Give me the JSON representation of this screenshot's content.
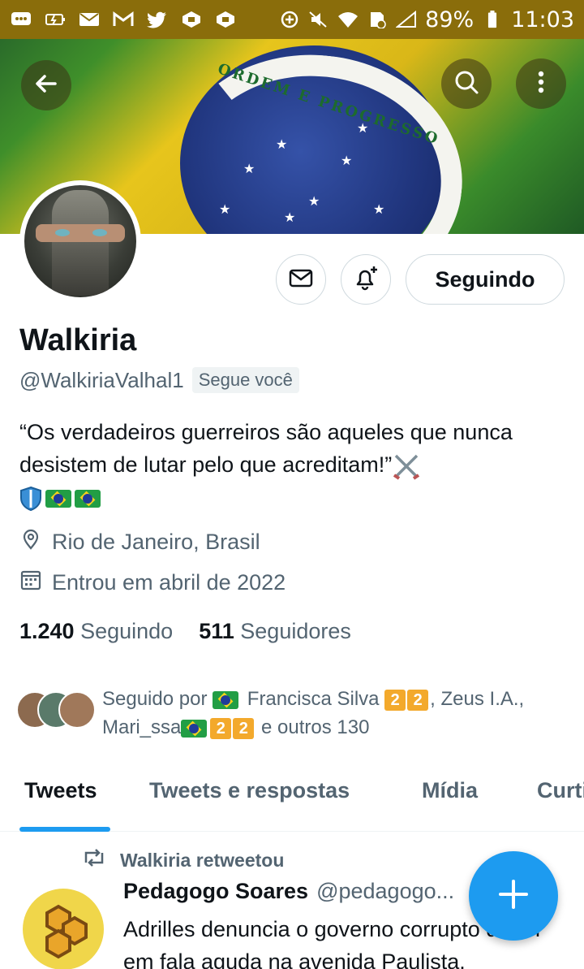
{
  "status_bar": {
    "battery": "89%",
    "time": "11:03",
    "icons": [
      "chat-icon",
      "battery-saver-icon",
      "mail-icon",
      "gmail-icon",
      "twitter-icon",
      "app-icon",
      "app-icon",
      "add-circle-icon",
      "mute-icon",
      "wifi-icon",
      "no-data-icon",
      "signal-icon",
      "battery-icon"
    ]
  },
  "header": {
    "back_icon": "arrow-left-icon",
    "search_icon": "search-icon",
    "more_icon": "more-vertical-icon",
    "banner_motto": "ORDEM E PROGRESSO"
  },
  "profile": {
    "name": "Walkiria",
    "handle": "@WalkiriaValhal1",
    "follows_you": "Segue você",
    "bio_text": "“Os verdadeiros guerreiros são aqueles que nunca desistem de lutar pelo que acreditam!”",
    "location": "Rio de Janeiro, Brasil",
    "joined": "Entrou em abril de 2022",
    "following_count": "1.240",
    "following_label": "Seguindo",
    "followers_count": "511",
    "followers_label": "Seguidores"
  },
  "actions": {
    "message_icon": "mail-icon",
    "notify_icon": "bell-plus-icon",
    "follow_state": "Seguindo"
  },
  "followed_by": {
    "prefix": "Seguido por",
    "name1": "Francisca Silva",
    "name2": ", Zeus I.A.,",
    "name3": "Mari_ssa",
    "suffix": "e outros 130",
    "digit": "2"
  },
  "tabs": [
    {
      "label": "Tweets",
      "active": true
    },
    {
      "label": "Tweets e respostas",
      "active": false
    },
    {
      "label": "Mídia",
      "active": false
    },
    {
      "label": "Curtidas",
      "active": false
    }
  ],
  "tweet": {
    "retweet_label": "Walkiria retweetou",
    "author": "Pedagogo Soares",
    "author_handle": "@pedagogo...",
    "text": "Adrilles denuncia o governo corrupto do PT em fala aguda na avenida Paulista."
  },
  "fab": {
    "icon": "plus-icon"
  },
  "colors": {
    "accent": "#1d9bf0",
    "status_bar": "#8a6d0b",
    "text_secondary": "#536471"
  }
}
